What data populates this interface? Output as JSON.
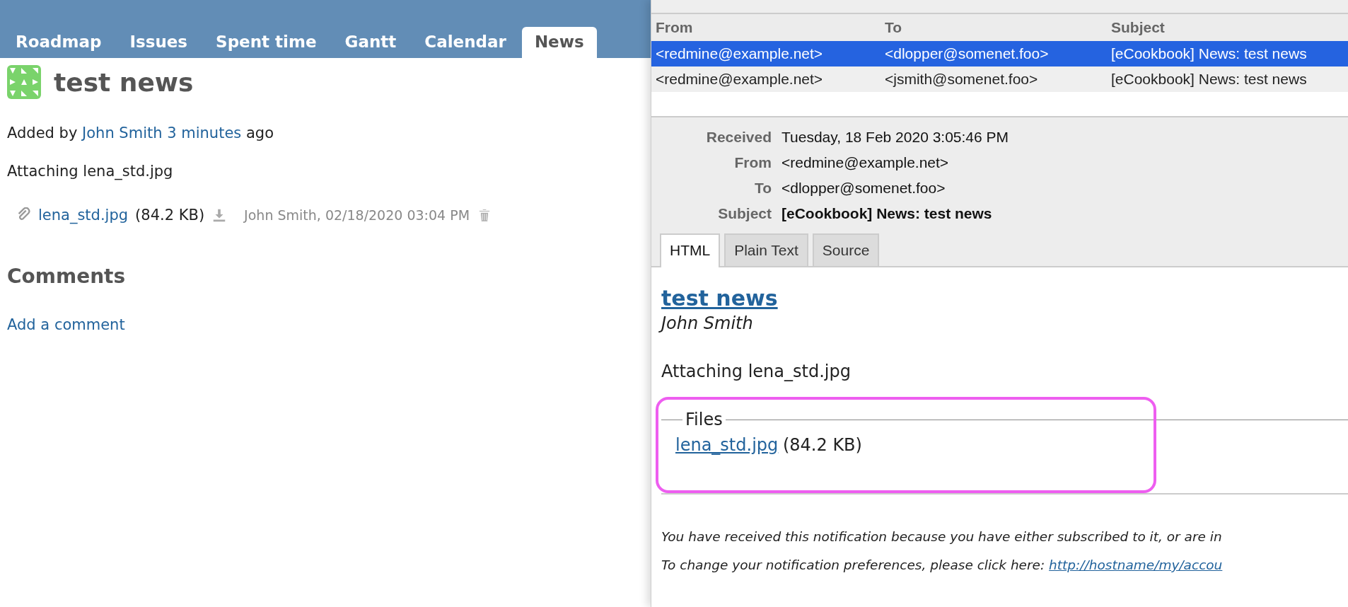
{
  "redmine": {
    "tabs": [
      {
        "label": "Roadmap",
        "selected": false
      },
      {
        "label": "Issues",
        "selected": false
      },
      {
        "label": "Spent time",
        "selected": false
      },
      {
        "label": "Gantt",
        "selected": false
      },
      {
        "label": "Calendar",
        "selected": false
      },
      {
        "label": "News",
        "selected": true
      }
    ],
    "news": {
      "title": "test news",
      "added_prefix": "Added by",
      "author": "John Smith",
      "age": "3 minutes",
      "added_suffix": "ago",
      "description": "Attaching lena_std.jpg",
      "attachment": {
        "filename": "lena_std.jpg",
        "size": "(84.2 KB)",
        "meta": "John Smith, 02/18/2020 03:04 PM"
      }
    },
    "comments": {
      "heading": "Comments",
      "add_link": "Add a comment"
    }
  },
  "mail": {
    "columns": [
      "From",
      "To",
      "Subject"
    ],
    "messages": [
      {
        "from": "<redmine@example.net>",
        "to": "<dlopper@somenet.foo>",
        "subject": "[eCookbook] News: test news",
        "selected": true
      },
      {
        "from": "<redmine@example.net>",
        "to": "<jsmith@somenet.foo>",
        "subject": "[eCookbook] News: test news",
        "selected": false
      }
    ],
    "headers": [
      {
        "label": "Received",
        "value": "Tuesday, 18 Feb 2020 3:05:46 PM",
        "bold": false
      },
      {
        "label": "From",
        "value": "<redmine@example.net>",
        "bold": false
      },
      {
        "label": "To",
        "value": "<dlopper@somenet.foo>",
        "bold": false
      },
      {
        "label": "Subject",
        "value": "[eCookbook] News: test news",
        "bold": true
      }
    ],
    "view_tabs": [
      {
        "label": "HTML",
        "selected": true
      },
      {
        "label": "Plain Text",
        "selected": false
      },
      {
        "label": "Source",
        "selected": false
      }
    ],
    "body": {
      "title": "test news",
      "author": "John Smith",
      "description": "Attaching lena_std.jpg",
      "files_legend": "Files",
      "file": "lena_std.jpg",
      "file_size": "(84.2 KB)",
      "footer_line": "You have received this notification because you have either subscribed to it, or are in",
      "footer_prefix": "To change your notification preferences, please click here:",
      "footer_link": "http://hostname/my/accou"
    }
  }
}
